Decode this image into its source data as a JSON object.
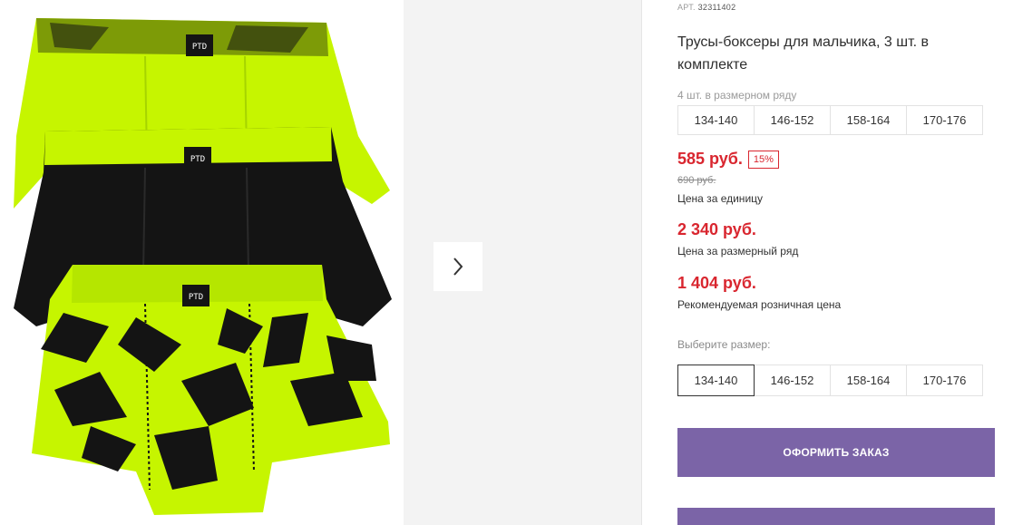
{
  "product": {
    "article_label": "АРТ.",
    "article_number": "32311402",
    "title": "Трусы-боксеры для мальчика, 3 шт. в комплекте",
    "brand_label": "PTD"
  },
  "size_row": {
    "caption": "4 шт. в размерном ряду",
    "sizes": [
      "134-140",
      "146-152",
      "158-164",
      "170-176"
    ]
  },
  "pricing": {
    "unit_price": "585 руб.",
    "discount_badge": "15%",
    "old_price": "690 руб.",
    "unit_caption": "Цена за единицу",
    "row_price": "2 340 руб.",
    "row_caption": "Цена за размерный ряд",
    "retail_price": "1 404 руб.",
    "retail_caption": "Рекомендуемая розничная цена"
  },
  "size_select": {
    "caption": "Выберите размер:",
    "options": [
      "134-140",
      "146-152",
      "158-164",
      "170-176"
    ],
    "selected": "134-140"
  },
  "actions": {
    "order_label": "ОФОРМИТЬ ЗАКАЗ"
  },
  "icons": {
    "next": "chevron-right-icon"
  },
  "colors": {
    "accent": "#7b64a7",
    "price": "#d9262f",
    "neon": "#c6f500",
    "black": "#141414"
  }
}
